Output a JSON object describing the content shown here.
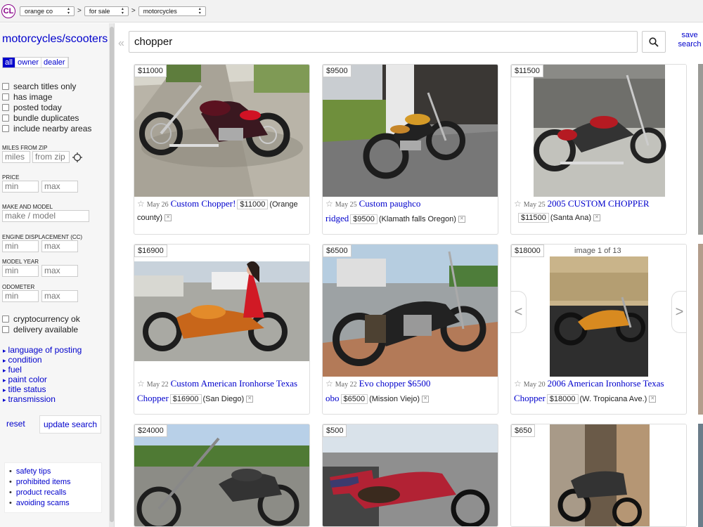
{
  "topbar": {
    "logo": "CL",
    "area": "orange co",
    "section": "for sale",
    "category": "motorcycles",
    "sep": ">"
  },
  "sidebar": {
    "title": "motorcycles/scooters",
    "seller_filter": [
      "all",
      "owner",
      "dealer"
    ],
    "checkboxes": [
      "search titles only",
      "has image",
      "posted today",
      "bundle duplicates",
      "include nearby areas"
    ],
    "miles_label": "MILES FROM ZIP",
    "miles_placeholder": "miles",
    "zip_placeholder": "from zip",
    "price_label": "PRICE",
    "make_label": "MAKE AND MODEL",
    "make_placeholder": "make / model",
    "engine_label": "ENGINE DISPLACEMENT (CC)",
    "year_label": "MODEL YEAR",
    "odometer_label": "ODOMETER",
    "min_placeholder": "min",
    "max_placeholder": "max",
    "checkboxes2": [
      "cryptocurrency ok",
      "delivery available"
    ],
    "links": [
      "language of posting",
      "condition",
      "fuel",
      "paint color",
      "title status",
      "transmission"
    ],
    "reset": "reset",
    "update": "update search",
    "help": [
      "safety tips",
      "prohibited items",
      "product recalls",
      "avoiding scams"
    ]
  },
  "search": {
    "query": "chopper",
    "save_label_1": "save",
    "save_label_2": "search",
    "collapse": "«"
  },
  "listings": [
    {
      "price": "$11000",
      "date": "May 26",
      "title": "Custom Chopper!",
      "price_inline": "$11000",
      "location": "(Orange county)"
    },
    {
      "price": "$9500",
      "date": "May 25",
      "title": "Custom paughco ridged",
      "price_inline": "$9500",
      "location": "(Klamath falls Oregon)"
    },
    {
      "price": "$11500",
      "date": "May 25",
      "title": "2005 CUSTOM CHOPPER",
      "price_inline": "$11500",
      "location": "(Santa Ana)"
    },
    {
      "price": "$16900",
      "date": "May 22",
      "title": "Custom American Ironhorse Texas Chopper",
      "price_inline": "$16900",
      "location": "(San Diego)"
    },
    {
      "price": "$6500",
      "date": "May 22",
      "title": "Evo chopper $6500 obo",
      "price_inline": "$6500",
      "location": "(Mission Viejo)"
    },
    {
      "price": "$18000",
      "date": "May 20",
      "title": "2006 American Ironhorse Texas Chopper",
      "price_inline": "$18000",
      "location": "(W. Tropicana Ave.)",
      "image_count": "image 1 of 13"
    },
    {
      "price": "$24000"
    },
    {
      "price": "$500"
    },
    {
      "price": "$650"
    }
  ],
  "colors": {
    "link": "#0000cc",
    "sidebar_bg": "#f6f6f6",
    "logo": "#880088"
  },
  "carousel": {
    "prev": "<",
    "next": ">"
  }
}
